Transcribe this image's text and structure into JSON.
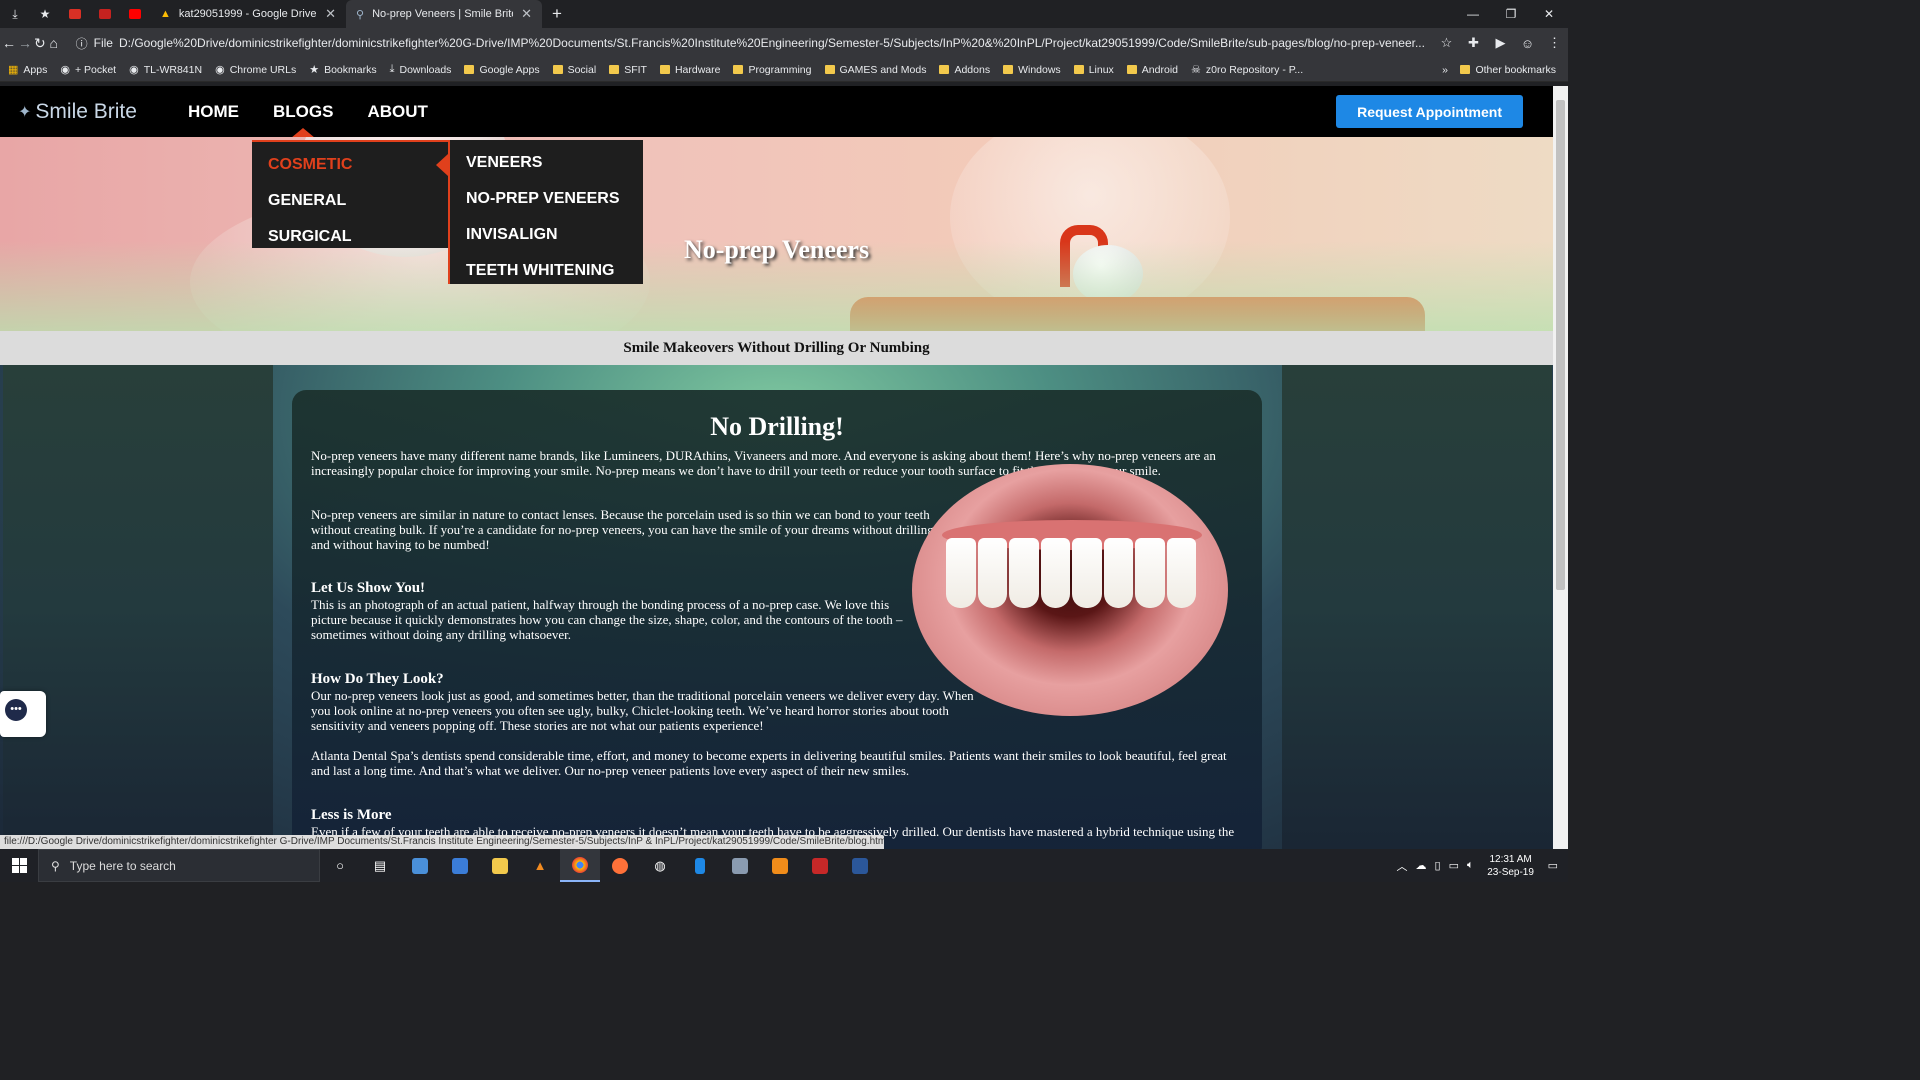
{
  "browser": {
    "tabs": [
      {
        "title": "kat29051999 - Google Drive",
        "favicon": "google-drive-icon"
      },
      {
        "title": "No-prep Veneers | Smile Brite",
        "favicon": "tooth-icon"
      }
    ],
    "address_scheme": "File",
    "url": "D:/Google%20Drive/dominicstrikefighter/dominicstrikefighter%20G-Drive/IMP%20Documents/St.Francis%20Institute%20Engineering/Semester-5/Subjects/InP%20&%20InPL/Project/kat29051999/Code/SmileBrite/sub-pages/blog/no-prep-veneer...",
    "bookmarks": [
      "Apps",
      "+ Pocket",
      "TL-WR841N",
      "Chrome URLs",
      "Bookmarks",
      "Downloads",
      "Google Apps",
      "Social",
      "SFIT",
      "Hardware",
      "Programming",
      "GAMES and Mods",
      "Addons",
      "Windows",
      "Linux",
      "Android",
      "z0ro Repository - P..."
    ],
    "bookmarks_more": "»",
    "other_bookmarks": "Other bookmarks",
    "status_url": "file:///D:/Google Drive/dominicstrikefighter/dominicstrikefighter G-Drive/IMP Documents/St.Francis Institute Engineering/Semester-5/Subjects/InP & InPL/Project/kat29051999/Code/SmileBrite/blog.html"
  },
  "site": {
    "logo": "Smile Brite",
    "nav": [
      "HOME",
      "BLOGS",
      "ABOUT"
    ],
    "cta": "Request Appointment",
    "blog_menu": [
      "COSMETIC",
      "GENERAL",
      "SURGICAL"
    ],
    "cosmetic_menu": [
      "VENEERS",
      "NO-PREP VENEERS",
      "INVISALIGN",
      "TEETH WHITENING"
    ],
    "hero_title": "No-prep Veneers",
    "subtitle": "Smile Makeovers Without Drilling Or Numbing",
    "accent_color": "#e0401c",
    "cta_color": "#1e88e5"
  },
  "article": {
    "heading": "No Drilling!",
    "p1": "No-prep veneers have many different name brands, like Lumineers, DURAthins, Vivaneers and more. And everyone is asking about them! Here’s why no-prep veneers are an increasingly popular choice for improving your smile. No-prep means we don’t have to drill your teeth or reduce your tooth surface to fit the veneers to your smile.",
    "p2": "No-prep veneers are similar in nature to contact lenses. Because the porcelain used is so thin we can bond to your teeth without creating bulk. If you’re a candidate for no-prep veneers, you can have the smile of your dreams without drilling and without having to be numbed!",
    "h_show": "Let Us Show You!",
    "p3": "This is an photograph of an actual patient, halfway through the bonding process of a no-prep case. We love this picture because it quickly demonstrates how you can change the size, shape, color, and the contours of the tooth – sometimes without doing any drilling whatsoever.",
    "h_look": "How Do They Look?",
    "p4": "Our no-prep veneers look just as good, and sometimes better, than the traditional porcelain veneers we deliver every day. When you look online at no-prep veneers you often see ugly, bulky, Chiclet-looking teeth. We’ve heard horror stories about tooth sensitivity and veneers popping off. These stories are not what our patients experience!",
    "p5": "Atlanta Dental Spa’s dentists spend considerable time, effort, and money to become experts in delivering beautiful smiles. Patients want their smiles to look beautiful, feel great and last a long time. And that’s what we deliver. Our no-prep veneer patients love every aspect of their new smiles.",
    "h_less": "Less is More",
    "p6": "Even if a few of your teeth are able to receive no-prep veneers it doesn’t mean your teeth have to be aggressively drilled. Our dentists have mastered a hybrid technique using the ...ome that are completely no-prep"
  },
  "taskbar": {
    "search_placeholder": "Type here to search",
    "time": "12:31 AM",
    "date": "23-Sep-19"
  }
}
